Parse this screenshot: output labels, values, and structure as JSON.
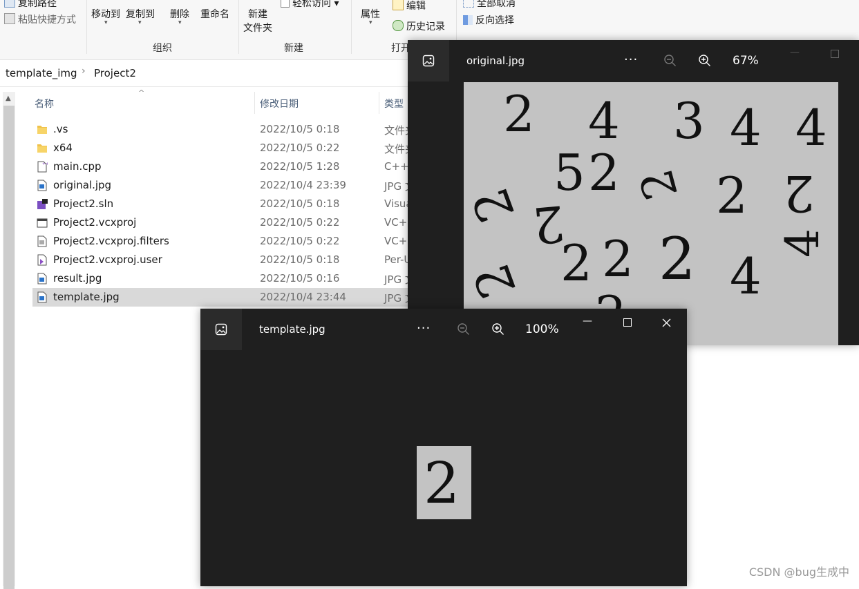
{
  "ribbon": {
    "copy_path": "复制路径",
    "paste_shortcut": "粘贴快捷方式",
    "move_to": "移动到",
    "copy_to": "复制到",
    "delete": "删除",
    "rename": "重命名",
    "new_folder_1": "新建",
    "new_folder_2": "文件夹",
    "easy_access": "轻松访问",
    "properties": "属性",
    "edit": "编辑",
    "history": "历史记录",
    "select_none": "全部取消",
    "invert_selection": "反向选择",
    "group_organize": "组织",
    "group_new": "新建",
    "group_open": "打开"
  },
  "breadcrumb": [
    "template_img",
    "Project2"
  ],
  "columns": {
    "name": "名称",
    "date": "修改日期",
    "type": "类型"
  },
  "files": [
    {
      "name": ".vs",
      "date": "2022/10/5 0:18",
      "type": "文件夹",
      "icon": "folder-icon"
    },
    {
      "name": "x64",
      "date": "2022/10/5 0:22",
      "type": "文件夹",
      "icon": "folder-icon"
    },
    {
      "name": "main.cpp",
      "date": "2022/10/5 1:28",
      "type": "C++",
      "icon": "cpp-file-icon"
    },
    {
      "name": "original.jpg",
      "date": "2022/10/4 23:39",
      "type": "JPG 文件",
      "icon": "image-file-icon"
    },
    {
      "name": "Project2.sln",
      "date": "2022/10/5 0:18",
      "type": "Visual",
      "icon": "solution-file-icon"
    },
    {
      "name": "Project2.vcxproj",
      "date": "2022/10/5 0:22",
      "type": "VC++",
      "icon": "project-file-icon"
    },
    {
      "name": "Project2.vcxproj.filters",
      "date": "2022/10/5 0:22",
      "type": "VC++",
      "icon": "filters-file-icon"
    },
    {
      "name": "Project2.vcxproj.user",
      "date": "2022/10/5 0:18",
      "type": "Per-U",
      "icon": "user-file-icon"
    },
    {
      "name": "result.jpg",
      "date": "2022/10/5 0:16",
      "type": "JPG 文件",
      "icon": "image-file-icon"
    },
    {
      "name": "template.jpg",
      "date": "2022/10/4 23:44",
      "type": "JPG 文件",
      "icon": "image-file-icon",
      "selected": true
    }
  ],
  "viewer_original": {
    "title": "original.jpg",
    "zoom": "67%",
    "more": "···"
  },
  "viewer_template": {
    "title": "template.jpg",
    "zoom": "100%",
    "more": "···"
  },
  "watermark": "CSDN @bug生成中",
  "colors": {
    "viewer_bg": "#1f1f1f",
    "image_bg": "#c3c3c3",
    "selected_row": "#d9d9d9"
  }
}
